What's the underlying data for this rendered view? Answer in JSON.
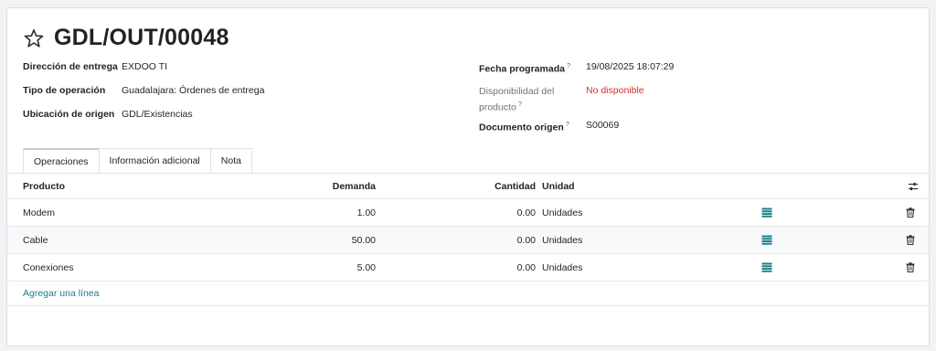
{
  "record": {
    "title": "GDL/OUT/00048"
  },
  "left_fields": [
    {
      "label": "Dirección de entrega",
      "value": "EXDOO TI"
    },
    {
      "label": "Tipo de operación",
      "value": "Guadalajara: Órdenes de entrega"
    },
    {
      "label": "Ubicación de origen",
      "value": "GDL/Existencias"
    }
  ],
  "right_fields": {
    "scheduled_label": "Fecha programada",
    "scheduled_value": "19/08/2025 18:07:29",
    "availability_label_1": "Disponibilidad del",
    "availability_label_2": "producto",
    "availability_value": "No disponible",
    "origin_label": "Documento origen",
    "origin_value": "S00069",
    "help_mark": "?"
  },
  "tabs": [
    "Operaciones",
    "Información adicional",
    "Nota"
  ],
  "table": {
    "headers": {
      "product": "Producto",
      "demand": "Demanda",
      "quantity": "Cantidad",
      "unit": "Unidad"
    },
    "rows": [
      {
        "product": "Modem",
        "demand": "1.00",
        "quantity": "0.00",
        "unit": "Unidades"
      },
      {
        "product": "Cable",
        "demand": "50.00",
        "quantity": "0.00",
        "unit": "Unidades"
      },
      {
        "product": "Conexiones",
        "demand": "5.00",
        "quantity": "0.00",
        "unit": "Unidades"
      }
    ],
    "add_line": "Agregar una línea"
  },
  "colors": {
    "accent": "#1a7f86",
    "warning": "#d0312d",
    "help": "#2d7fb8"
  },
  "icons": {
    "favorite": "star-icon",
    "settings": "sliders-icon",
    "detail": "list-icon",
    "delete": "trash-icon"
  }
}
